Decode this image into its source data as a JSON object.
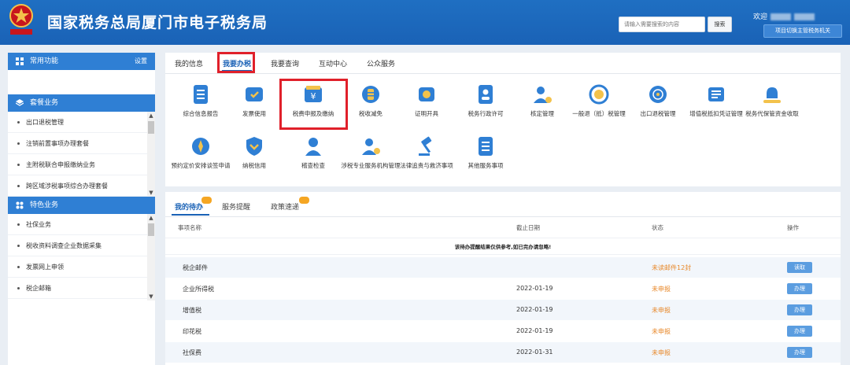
{
  "header": {
    "title": "国家税务总局厦门市电子税务局",
    "emblem_text": "中国税务",
    "search_placeholder": "请输入需要搜索的内容",
    "search_button": "搜索",
    "welcome": "欢迎",
    "switch_button": "项目切换主管税务机关",
    "bg_color": "#1a62b6"
  },
  "sidebar": {
    "common": {
      "title": "常用功能",
      "action": "设置"
    },
    "package": {
      "title": "套餐业务",
      "items": [
        "出口退税管理",
        "注销前置事项办理套餐",
        "主附税联合申报缴纳业务",
        "跨区域涉税事项综合办理套餐"
      ]
    },
    "special": {
      "title": "特色业务",
      "items": [
        "社保业务",
        "税收资料调查企业数据采集",
        "发票网上申领",
        "税企邮箱"
      ]
    }
  },
  "main_tabs": [
    {
      "label": "我的信息",
      "active": false
    },
    {
      "label": "我要办税",
      "active": true
    },
    {
      "label": "我要查询",
      "active": false
    },
    {
      "label": "互动中心",
      "active": false
    },
    {
      "label": "公众服务",
      "active": false
    }
  ],
  "tiles": [
    {
      "label": "综合信息报告",
      "icon": "report-icon"
    },
    {
      "label": "发票使用",
      "icon": "invoice-icon"
    },
    {
      "label": "税费申报及缴纳",
      "icon": "yuan-wallet-icon",
      "highlighted": true
    },
    {
      "label": "税收减免",
      "icon": "coins-icon"
    },
    {
      "label": "证明开具",
      "icon": "certificate-icon"
    },
    {
      "label": "税务行政许可",
      "icon": "license-icon"
    },
    {
      "label": "核定管理",
      "icon": "user-gear-icon"
    },
    {
      "label": "一般退（抵）税管理",
      "icon": "refund-cycle-icon"
    },
    {
      "label": "出口退税管理",
      "icon": "globe-icon"
    },
    {
      "label": "增值税抵扣凭证管理",
      "icon": "voucher-icon"
    },
    {
      "label": "税务代保管资金收取",
      "icon": "money-bag-icon"
    },
    {
      "label": "预约定价安排谈签申请",
      "icon": "compass-icon"
    },
    {
      "label": "纳税信用",
      "icon": "shield-heart-icon"
    },
    {
      "label": "稽查检查",
      "icon": "inspector-icon"
    },
    {
      "label": "涉税专业服务机构管理",
      "icon": "agent-icon"
    },
    {
      "label": "法律追责与救济事项",
      "icon": "gavel-icon"
    },
    {
      "label": "其他服务事项",
      "icon": "list-icon"
    }
  ],
  "lower_tabs": [
    {
      "label": "我的待办",
      "active": true,
      "badge": ""
    },
    {
      "label": "服务提醒",
      "active": false
    },
    {
      "label": "政策速递",
      "active": false,
      "badge": ""
    }
  ],
  "table": {
    "columns": [
      "事项名称",
      "截止日期",
      "状态",
      "操作"
    ],
    "notice": "该待办提醒结果仅供参考,如已完办请忽略!",
    "rows": [
      {
        "name": "税企邮件",
        "date": "",
        "status": "未读邮件12封",
        "action": "读取"
      },
      {
        "name": "企业所得税",
        "date": "2022-01-19",
        "status": "未申报",
        "action": "办理"
      },
      {
        "name": "增值税",
        "date": "2022-01-19",
        "status": "未申报",
        "action": "办理"
      },
      {
        "name": "印花税",
        "date": "2022-01-19",
        "status": "未申报",
        "action": "办理"
      },
      {
        "name": "社保费",
        "date": "2022-01-31",
        "status": "未申报",
        "action": "办理"
      }
    ]
  }
}
